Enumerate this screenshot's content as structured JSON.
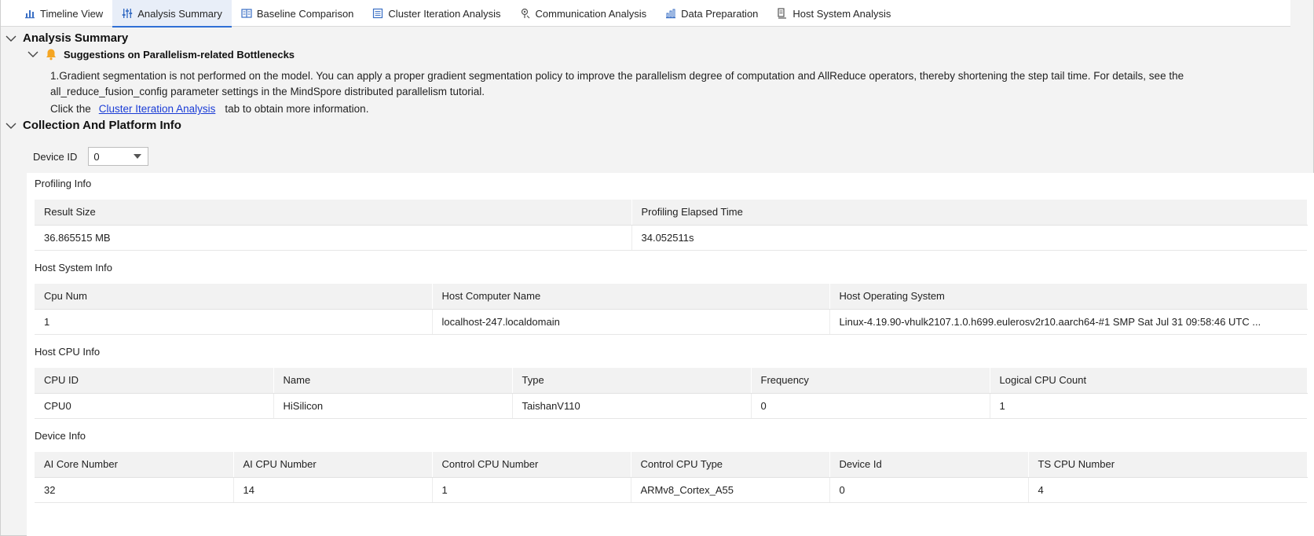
{
  "tabs": [
    {
      "label": "Timeline View",
      "icon": "bar-chart-icon"
    },
    {
      "label": "Analysis Summary",
      "icon": "sliders-icon"
    },
    {
      "label": "Baseline Comparison",
      "icon": "compare-icon"
    },
    {
      "label": "Cluster Iteration Analysis",
      "icon": "cluster-icon"
    },
    {
      "label": "Communication Analysis",
      "icon": "signal-icon"
    },
    {
      "label": "Data Preparation",
      "icon": "data-icon"
    },
    {
      "label": "Host System Analysis",
      "icon": "host-icon"
    }
  ],
  "active_tab": "Analysis Summary",
  "summary": {
    "title": "Analysis Summary",
    "suggestion_title": "Suggestions on Parallelism-related Bottlenecks",
    "paragraph": "1.Gradient segmentation is not performed on the model. You can apply a proper gradient segmentation policy to improve the parallelism degree of computation and AllReduce operators, thereby shortening the step tail time. For details, see the all_reduce_fusion_config parameter settings in the MindSpore distributed parallelism tutorial.",
    "click_prefix": "Click the",
    "link_text": "Cluster Iteration Analysis",
    "click_suffix": "tab to obtain more information."
  },
  "collection": {
    "title": "Collection And Platform Info",
    "device_id_label": "Device ID",
    "device_id_value": "0"
  },
  "profiling": {
    "title": "Profiling Info",
    "headers": [
      "Result Size",
      "Profiling Elapsed Time"
    ],
    "row": [
      "36.865515 MB",
      "34.052511s"
    ]
  },
  "host_system": {
    "title": "Host System Info",
    "headers": [
      "Cpu Num",
      "Host Computer Name",
      "Host Operating System"
    ],
    "row": [
      "1",
      "localhost-247.localdomain",
      "Linux-4.19.90-vhulk2107.1.0.h699.eulerosv2r10.aarch64-#1 SMP Sat Jul 31 09:58:46 UTC ..."
    ]
  },
  "host_cpu": {
    "title": "Host CPU Info",
    "headers": [
      "CPU ID",
      "Name",
      "Type",
      "Frequency",
      "Logical CPU Count"
    ],
    "row": [
      "CPU0",
      "HiSilicon",
      "TaishanV110",
      "0",
      "1"
    ]
  },
  "device_info": {
    "title": "Device Info",
    "headers": [
      "AI Core Number",
      "AI CPU Number",
      "Control CPU Number",
      "Control CPU Type",
      "Device Id",
      "TS CPU Number"
    ],
    "row": [
      "32",
      "14",
      "1",
      "ARMv8_Cortex_A55",
      "0",
      "4"
    ]
  },
  "colors": {
    "accent": "#2f6fd6",
    "link": "#1a3cd6",
    "bell": "#f5a623",
    "icon": "#3a6fc4"
  }
}
